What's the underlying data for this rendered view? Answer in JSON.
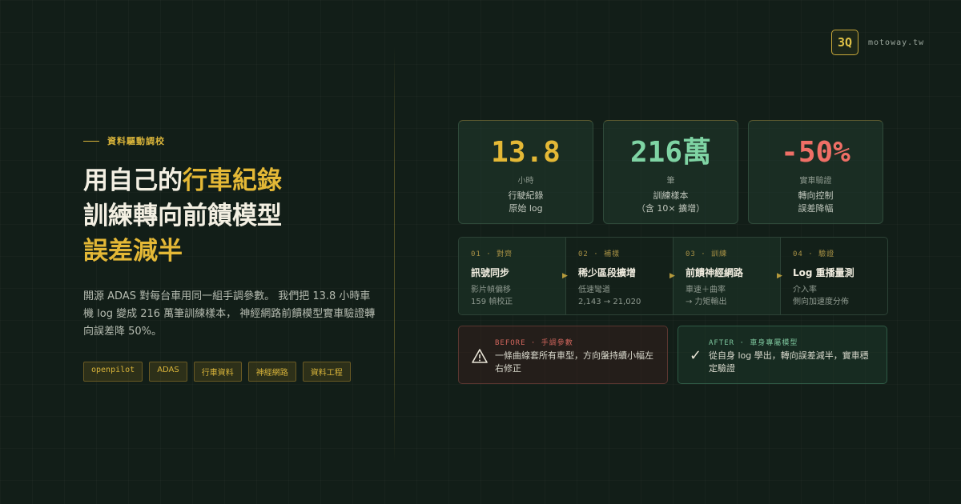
{
  "brand": {
    "logo_text": "3Q",
    "domain": "motoway.tw"
  },
  "eyebrow": "資料驅動調校",
  "title": {
    "line1_pre": "用自己的",
    "line1_hl": "行車紀錄",
    "line2": "訓練轉向前饋模型",
    "line3_hl": "誤差減半"
  },
  "description": "開源 ADAS 對每台車用同一組手調參數。 我們把 13.8 小時車機 log 變成 216 萬筆訓練樣本， 神經網路前饋模型實車驗證轉向誤差降 50%。",
  "tags": [
    "openpilot",
    "ADAS",
    "行車資料",
    "神經網路",
    "資料工程"
  ],
  "stats": [
    {
      "value": "13.8",
      "unit": "小時",
      "label1": "行駛紀錄",
      "label2": "原始 log",
      "color": "#e4b836"
    },
    {
      "value": "216萬",
      "unit": "筆",
      "label1": "訓練樣本",
      "label2": "（含 10× 擴增）",
      "color": "#7fd4a4"
    },
    {
      "value": "-50%",
      "unit": "實車驗證",
      "label1": "轉向控制",
      "label2": "誤差降幅",
      "color": "#ef6f66"
    }
  ],
  "pipeline": [
    {
      "num": "01 · 對齊",
      "title": "訊號同步",
      "detail": "影片幀偏移\n159 幀校正"
    },
    {
      "num": "02 · 補樣",
      "title": "稀少區段擴增",
      "detail": "低速彎道\n2,143 → 21,020"
    },
    {
      "num": "03 · 訓練",
      "title": "前饋神經網路",
      "detail": "車速＋曲率\n→ 力矩輸出"
    },
    {
      "num": "04 · 驗證",
      "title": "Log 重播量測",
      "detail": "介入率\n側向加速度分佈"
    }
  ],
  "before": {
    "head": "BEFORE · 手調參數",
    "text": "一條曲線套所有車型，方向盤持續小幅左右修正",
    "icon": "warning-icon"
  },
  "after": {
    "head": "AFTER · 車身專屬模型",
    "text": "從自身 log 學出，轉向誤差減半，實車穩定驗證",
    "icon": "check-icon"
  }
}
